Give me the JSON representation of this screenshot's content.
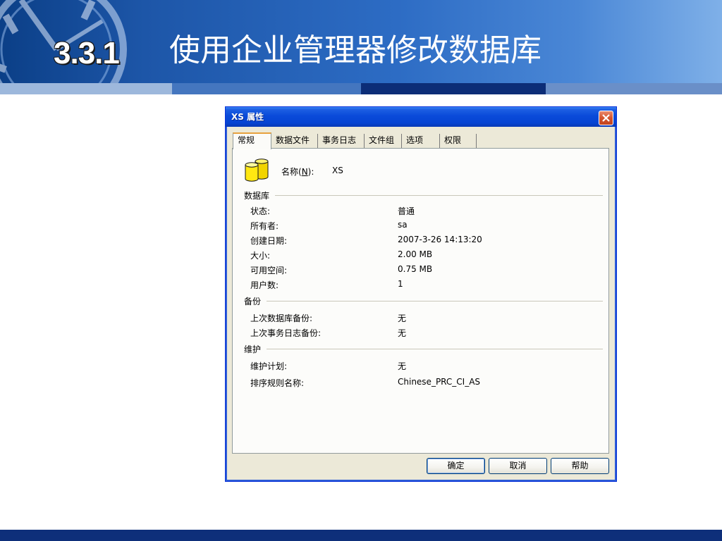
{
  "slide": {
    "section_number": "3.3.1",
    "title": "使用企业管理器修改数据库"
  },
  "dialog": {
    "title": "XS 属性",
    "tabs": [
      {
        "label": "常规",
        "active": true
      },
      {
        "label": "数据文件",
        "active": false
      },
      {
        "label": "事务日志",
        "active": false
      },
      {
        "label": "文件组",
        "active": false
      },
      {
        "label": "选项",
        "active": false
      },
      {
        "label": "权限",
        "active": false
      }
    ],
    "name_label_prefix": "名称(",
    "name_label_hotkey": "N",
    "name_label_suffix": "):",
    "name_value": "XS",
    "groups": {
      "database": {
        "title": "数据库",
        "rows": [
          {
            "label": "状态:",
            "value": "普通"
          },
          {
            "label": "所有者:",
            "value": "sa"
          },
          {
            "label": "创建日期:",
            "value": "2007-3-26 14:13:20"
          },
          {
            "label": "大小:",
            "value": "2.00 MB"
          },
          {
            "label": "可用空间:",
            "value": "0.75 MB"
          },
          {
            "label": "用户数:",
            "value": "1"
          }
        ]
      },
      "backup": {
        "title": "备份",
        "rows": [
          {
            "label": "上次数据库备份:",
            "value": "无"
          },
          {
            "label": "上次事务日志备份:",
            "value": "无"
          }
        ]
      },
      "maintenance": {
        "title": "维护",
        "rows": [
          {
            "label": "维护计划:",
            "value": "无"
          },
          {
            "label": "排序规则名称:",
            "value": "Chinese_PRC_CI_AS"
          }
        ]
      }
    },
    "buttons": {
      "ok": "确定",
      "cancel": "取消",
      "help": "帮助"
    }
  },
  "icons": {
    "close": "close-icon",
    "database": "database-icon",
    "clock_decoration": "clock-icon"
  },
  "colors": {
    "header_blue": "#1d56a8",
    "dialog_bg": "#ece9d8",
    "titlebar_blue": "#0a4ad9",
    "tab_active_accent": "#e7a13d",
    "footer_navy": "#0e2f7a"
  }
}
